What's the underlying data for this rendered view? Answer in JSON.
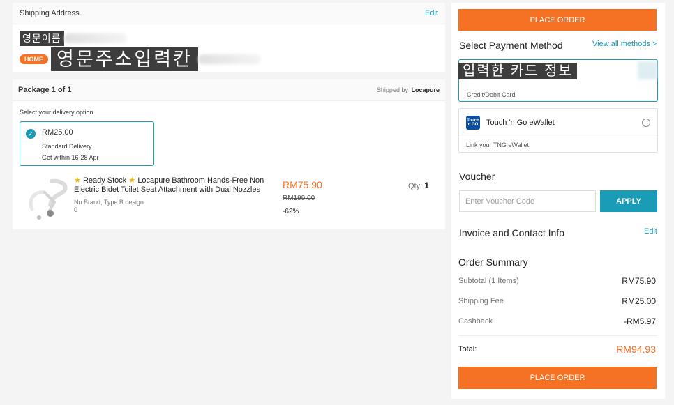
{
  "shipping": {
    "title": "Shipping Address",
    "edit_label": "Edit",
    "name_masked": "영문이름",
    "badge": "HOME",
    "address_masked": "영문주소입력칸"
  },
  "package": {
    "title": "Package 1 of 1",
    "shipped_by_label": "Shipped by",
    "seller": "Locapure",
    "delivery_prompt": "Select your delivery option",
    "delivery": {
      "price": "RM25.00",
      "type": "Standard Delivery",
      "eta": "Get within 16-28 Apr"
    },
    "product": {
      "title_part1": "Ready Stock",
      "title_part2": "Locapure Bathroom Hands-Free Non Electric Bidet Toilet Seat Attachment with Dual Nozzles",
      "variant": "No Brand, Type:B design",
      "extra": "0",
      "price": "RM75.90",
      "original_price": "RM199.00",
      "discount": "-62%",
      "qty_label": "Qty:",
      "qty": "1"
    }
  },
  "payment": {
    "place_order_label": "PLACE ORDER",
    "title": "Select Payment Method",
    "view_all": "View all methods >",
    "card_masked": "입력한 카드 정보",
    "card_label": "Credit/Debit Card",
    "tng_logo_text": "Touch n GO",
    "tng_name": "Touch 'n Go eWallet",
    "tng_sub": "Link your TNG eWallet"
  },
  "voucher": {
    "title": "Voucher",
    "placeholder": "Enter Voucher Code",
    "apply_label": "APPLY"
  },
  "invoice": {
    "title": "Invoice and Contact Info",
    "edit_label": "Edit"
  },
  "summary": {
    "title": "Order Summary",
    "subtotal_label": "Subtotal (1 Items)",
    "subtotal": "RM75.90",
    "shipping_label": "Shipping Fee",
    "shipping": "RM25.00",
    "cashback_label": "Cashback",
    "cashback": "-RM5.97",
    "total_label": "Total:",
    "total": "RM94.93"
  },
  "colors": {
    "accent_orange": "#f57224",
    "accent_teal": "#1a9cb7"
  }
}
